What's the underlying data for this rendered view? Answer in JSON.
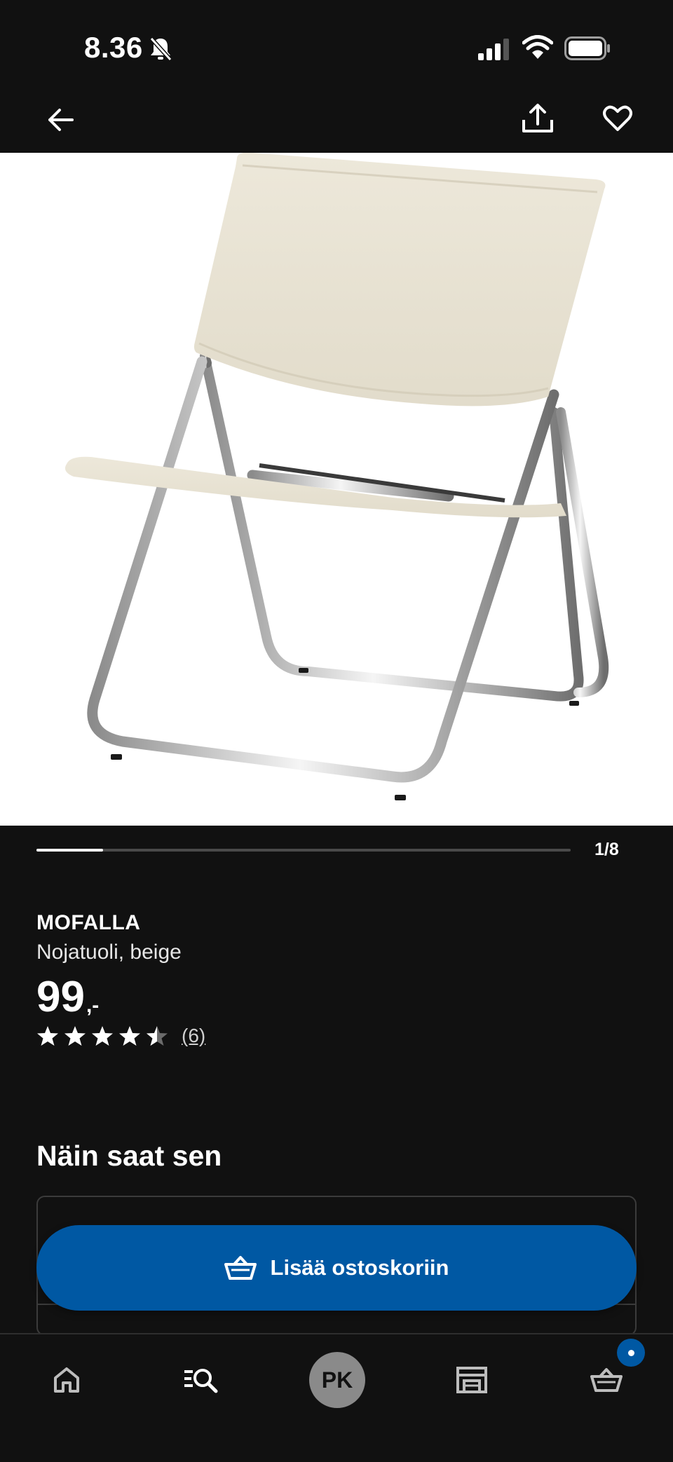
{
  "status_bar": {
    "time": "8.36",
    "icons": [
      "bell-off-icon",
      "cellular-signal-icon",
      "wifi-icon",
      "battery-icon"
    ]
  },
  "top_nav": {
    "icons": [
      "arrow-left-icon",
      "share-icon",
      "heart-icon"
    ]
  },
  "gallery": {
    "counter": "1/8",
    "current": 1,
    "total": 8
  },
  "product": {
    "name": "MOFALLA",
    "description": "Nojatuoli, beige",
    "price": "99",
    "price_suffix": ",-",
    "rating": 4.5,
    "rating_max": 5,
    "review_count": "(6)"
  },
  "delivery": {
    "title": "Näin saat sen"
  },
  "cta": {
    "label": "Lisää ostoskoriin",
    "color": "#0058a3",
    "icon": "basket-icon"
  },
  "bottom_nav": {
    "tabs": [
      {
        "name": "home",
        "icon": "home-icon"
      },
      {
        "name": "search",
        "icon": "search-list-icon"
      },
      {
        "name": "profile",
        "initials": "PK"
      },
      {
        "name": "stores",
        "icon": "store-icon"
      },
      {
        "name": "cart",
        "icon": "basket-icon"
      }
    ],
    "profile_initials": "PK"
  },
  "colors": {
    "background": "#111111",
    "accent": "#0058a3",
    "image_background": "#ffffff"
  }
}
